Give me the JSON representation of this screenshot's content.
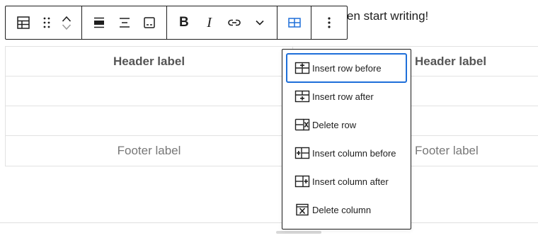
{
  "paragraph": {
    "text": "en start writing!"
  },
  "toolbar": {
    "buttons": [
      {
        "name": "table-block-icon"
      },
      {
        "name": "drag-handle-icon"
      },
      {
        "name": "move-up-icon"
      },
      {
        "name": "move-down-icon"
      },
      {
        "name": "align-wide-icon"
      },
      {
        "name": "align-center-icon"
      },
      {
        "name": "caption-icon"
      },
      {
        "name": "bold-icon",
        "glyph": "B"
      },
      {
        "name": "italic-icon",
        "glyph": "I"
      },
      {
        "name": "link-icon"
      },
      {
        "name": "more-formatting-chevron-icon"
      },
      {
        "name": "edit-table-icon"
      },
      {
        "name": "options-kebab-icon"
      }
    ],
    "accent_color": "#1e6fd9"
  },
  "table": {
    "headers": [
      "Header label",
      "Header label"
    ],
    "body_rows": [
      [
        "",
        ""
      ],
      [
        "",
        ""
      ]
    ],
    "footers": [
      "Footer label",
      "Footer label"
    ]
  },
  "menu": {
    "items": [
      {
        "label": "Insert row before",
        "icon": "table-row-before-icon",
        "focused": true
      },
      {
        "label": "Insert row after",
        "icon": "table-row-after-icon",
        "focused": false
      },
      {
        "label": "Delete row",
        "icon": "table-row-delete-icon",
        "focused": false
      },
      {
        "label": "Insert column before",
        "icon": "table-column-before-icon",
        "focused": false
      },
      {
        "label": "Insert column after",
        "icon": "table-column-after-icon",
        "focused": false
      },
      {
        "label": "Delete column",
        "icon": "table-column-delete-icon",
        "focused": false
      }
    ]
  }
}
